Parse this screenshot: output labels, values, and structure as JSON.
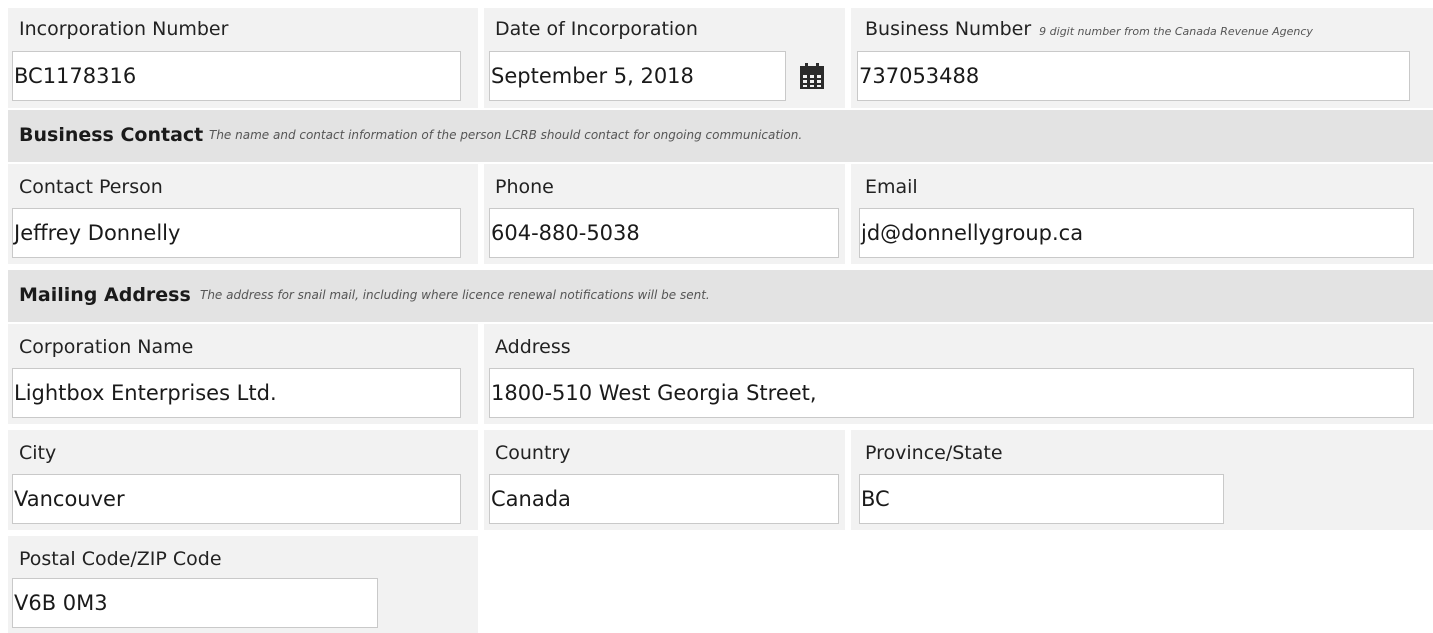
{
  "company": {
    "incorporation_number": {
      "label": "Incorporation Number",
      "value": "BC1178316"
    },
    "date_of_incorporation": {
      "label": "Date of Incorporation",
      "value": "September 5, 2018"
    },
    "business_number": {
      "label": "Business Number",
      "hint": "9 digit number from the Canada Revenue Agency",
      "value": "737053488"
    }
  },
  "business_contact": {
    "title": "Business Contact",
    "description": "The name and contact information of the person LCRB should contact for ongoing communication.",
    "contact_person": {
      "label": "Contact Person",
      "value": "Jeffrey Donnelly"
    },
    "phone": {
      "label": "Phone",
      "value": "604-880-5038"
    },
    "email": {
      "label": "Email",
      "value": "jd@donnellygroup.ca"
    }
  },
  "mailing_address": {
    "title": "Mailing Address",
    "description": "The address for snail mail, including where licence renewal notifications will be sent.",
    "corporation_name": {
      "label": "Corporation Name",
      "value": "Lightbox Enterprises Ltd."
    },
    "address": {
      "label": "Address",
      "value": "1800-510 West Georgia Street,"
    },
    "city": {
      "label": "City",
      "value": "Vancouver"
    },
    "country": {
      "label": "Country",
      "value": "Canada"
    },
    "province_state": {
      "label": "Province/State",
      "value": "BC"
    },
    "postal_code": {
      "label": "Postal Code/ZIP Code",
      "value": "V6B 0M3"
    }
  },
  "icons": {
    "date_picker": "calendar-icon"
  }
}
